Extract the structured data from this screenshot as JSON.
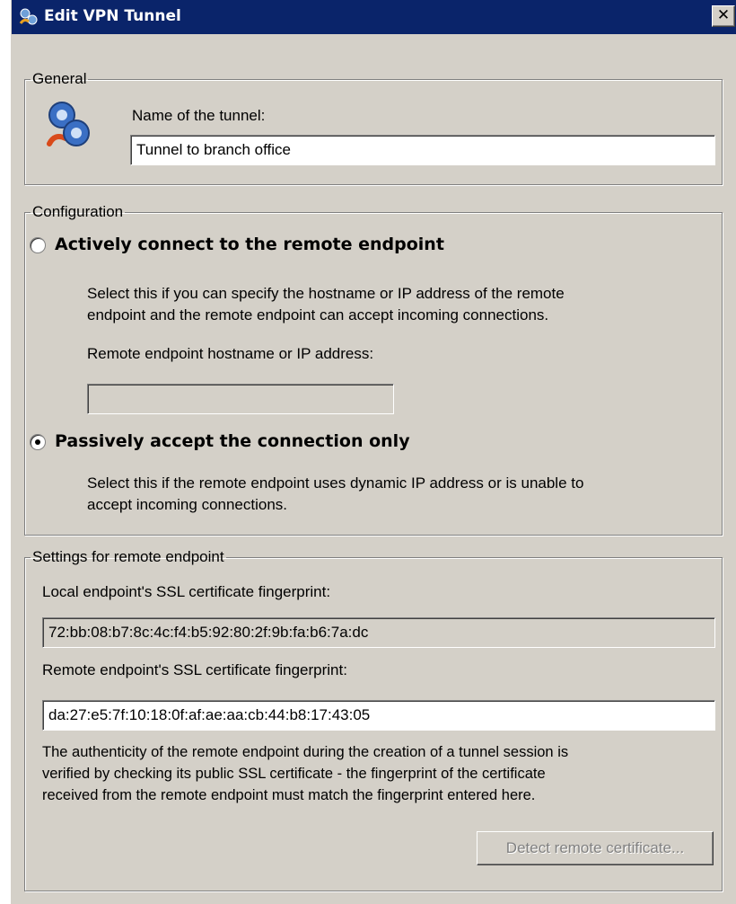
{
  "window": {
    "title": "Edit VPN Tunnel",
    "close_glyph": "✕",
    "title_icon": "vpn-tunnel-icon"
  },
  "general": {
    "legend": "General",
    "icon": "vpn-network-icon",
    "name_label": "Name of the tunnel:",
    "name_value": "Tunnel to branch office"
  },
  "configuration": {
    "legend": "Configuration",
    "active_option": {
      "label": "Actively connect to the remote endpoint",
      "checked": false,
      "description_line1": "Select this if you can specify the hostname or IP address of the remote",
      "description_line2": "endpoint and the remote endpoint can accept incoming connections.",
      "hostname_label": "Remote endpoint hostname or IP address:",
      "hostname_value": ""
    },
    "passive_option": {
      "label": "Passively accept the connection only",
      "checked": true,
      "description_line1": "Select this if the remote endpoint uses dynamic IP address or is unable to",
      "description_line2": "accept incoming connections."
    }
  },
  "remote_settings": {
    "legend": "Settings for remote endpoint",
    "local_fingerprint_label": "Local endpoint's SSL certificate fingerprint:",
    "local_fingerprint_value": "72:bb:08:b7:8c:4c:f4:b5:92:80:2f:9b:fa:b6:7a:dc",
    "remote_fingerprint_label": "Remote endpoint's SSL certificate fingerprint:",
    "remote_fingerprint_value": "da:27:e5:7f:10:18:0f:af:ae:aa:cb:44:b8:17:43:05",
    "info_line1": "The authenticity of the remote endpoint during the creation of a tunnel session is",
    "info_line2": "verified by checking its public SSL certificate - the fingerprint of the certificate",
    "info_line3": "received from the remote endpoint must match the fingerprint entered here.",
    "detect_button_label": "Detect remote certificate..."
  },
  "colors": {
    "titlebar": "#0a246a",
    "dialog_face": "#d4d0c8"
  }
}
